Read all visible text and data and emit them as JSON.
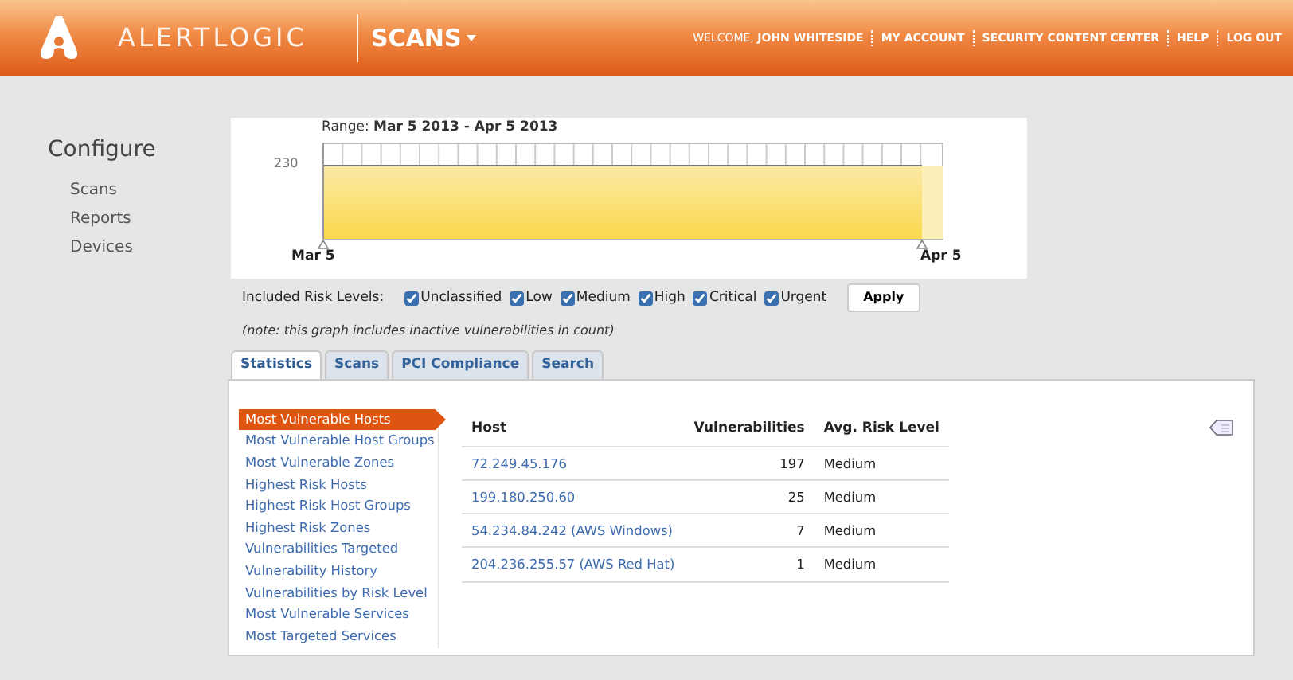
{
  "header": {
    "brand": "ALERTLOGIC",
    "section": "SCANS",
    "links": [
      "WELCOME, **JOHN WHITESIDE**",
      "MY ACCOUNT",
      "SECURITY CONTENT CENTER",
      "HELP",
      "LOG OUT"
    ]
  },
  "sidebar": {
    "title": "Configure",
    "items": [
      "Scans",
      "Reports",
      "Devices"
    ]
  },
  "chart": {
    "range_label": "Range:",
    "range": "Mar 5 2013 - Apr 5 2013",
    "y_tick": "230",
    "start_label": "Mar 5",
    "end_label": "Apr 5"
  },
  "risk_levels": {
    "label": "Included Risk Levels:",
    "items": [
      {
        "label": "Unclassified",
        "checked": true
      },
      {
        "label": "Low",
        "checked": true
      },
      {
        "label": "Medium",
        "checked": true
      },
      {
        "label": "High",
        "checked": true
      },
      {
        "label": "Critical",
        "checked": true
      },
      {
        "label": "Urgent",
        "checked": true
      }
    ],
    "apply": "Apply",
    "note": "(note: this graph includes inactive vulnerabilities in count)"
  },
  "tabs": [
    {
      "label": "Statistics",
      "selected": true
    },
    {
      "label": "Scans",
      "selected": false
    },
    {
      "label": "PCI Compliance",
      "selected": false
    },
    {
      "label": "Search",
      "selected": false
    }
  ],
  "reports": [
    {
      "label": "Most Vulnerable Hosts",
      "selected": true
    },
    {
      "label": "Most Vulnerable Host Groups",
      "selected": false
    },
    {
      "label": "Most Vulnerable Zones",
      "selected": false
    },
    {
      "label": "Highest Risk Hosts",
      "selected": false
    },
    {
      "label": "Highest Risk Host Groups",
      "selected": false
    },
    {
      "label": "Highest Risk Zones",
      "selected": false
    },
    {
      "label": "Vulnerabilities Targeted",
      "selected": false
    },
    {
      "label": "Vulnerability History",
      "selected": false
    },
    {
      "label": "Vulnerabilities by Risk Level",
      "selected": false
    },
    {
      "label": "Most Vulnerable Services",
      "selected": false
    },
    {
      "label": "Most Targeted Services",
      "selected": false
    }
  ],
  "table": {
    "columns": [
      "Host",
      "Vulnerabilities",
      "Avg. Risk Level"
    ],
    "rows": [
      [
        "72.249.45.176",
        "197",
        "Medium"
      ],
      [
        "199.180.250.60",
        "25",
        "Medium"
      ],
      [
        "54.234.84.242 (AWS Windows)",
        "7",
        "Medium"
      ],
      [
        "204.236.255.57 (AWS Red Hat)",
        "1",
        "Medium"
      ]
    ]
  }
}
